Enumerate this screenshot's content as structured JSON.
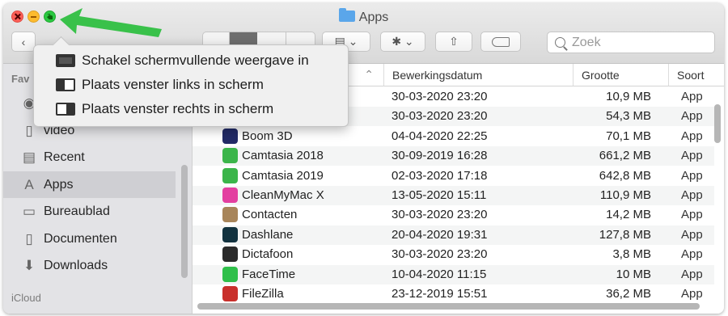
{
  "window": {
    "title": "Apps"
  },
  "toolbar": {
    "back_icon": "chevron-left-icon",
    "search_placeholder": "Zoek"
  },
  "popup": {
    "items": [
      {
        "label": "Schakel schermvullende weergave in",
        "icon": "fullscreen-icon"
      },
      {
        "label": "Plaats venster links in scherm",
        "icon": "tile-left-icon"
      },
      {
        "label": "Plaats venster rechts in scherm",
        "icon": "tile-right-icon"
      }
    ]
  },
  "sidebar": {
    "favorites_header": "Fav",
    "items": [
      {
        "label": "",
        "icon": "airdrop-icon"
      },
      {
        "label": "video",
        "icon": "document-icon"
      },
      {
        "label": "Recent",
        "icon": "clock-icon"
      },
      {
        "label": "Apps",
        "icon": "apps-icon",
        "selected": true
      },
      {
        "label": "Bureaublad",
        "icon": "desktop-icon"
      },
      {
        "label": "Documenten",
        "icon": "document-icon"
      },
      {
        "label": "Downloads",
        "icon": "download-icon"
      }
    ],
    "icloud_header": "iCloud"
  },
  "columns": {
    "name": "",
    "date": "Bewerkingsdatum",
    "size": "Grootte",
    "kind": "Soort"
  },
  "files": [
    {
      "name": "",
      "date": "30-03-2020 23:20",
      "size": "10,9 MB",
      "kind": "App",
      "color": "#ffffff"
    },
    {
      "name": "",
      "date": "30-03-2020 23:20",
      "size": "54,3 MB",
      "kind": "App",
      "color": "#ffffff"
    },
    {
      "name": "Boom 3D",
      "date": "04-04-2020 22:25",
      "size": "70,1 MB",
      "kind": "App",
      "color": "#222a66"
    },
    {
      "name": "Camtasia 2018",
      "date": "30-09-2019 16:28",
      "size": "661,2 MB",
      "kind": "App",
      "color": "#3bb54a"
    },
    {
      "name": "Camtasia 2019",
      "date": "02-03-2020 17:18",
      "size": "642,8 MB",
      "kind": "App",
      "color": "#3bb54a"
    },
    {
      "name": "CleanMyMac X",
      "date": "13-05-2020 15:11",
      "size": "110,9 MB",
      "kind": "App",
      "color": "#e33fa0"
    },
    {
      "name": "Contacten",
      "date": "30-03-2020 23:20",
      "size": "14,2 MB",
      "kind": "App",
      "color": "#a8855a"
    },
    {
      "name": "Dashlane",
      "date": "20-04-2020 19:31",
      "size": "127,8 MB",
      "kind": "App",
      "color": "#12323f"
    },
    {
      "name": "Dictafoon",
      "date": "30-03-2020 23:20",
      "size": "3,8 MB",
      "kind": "App",
      "color": "#2b2b2b"
    },
    {
      "name": "FaceTime",
      "date": "10-04-2020 11:15",
      "size": "10 MB",
      "kind": "App",
      "color": "#2fbf4a"
    },
    {
      "name": "FileZilla",
      "date": "23-12-2019 15:51",
      "size": "36,2 MB",
      "kind": "App",
      "color": "#c9302c"
    }
  ]
}
